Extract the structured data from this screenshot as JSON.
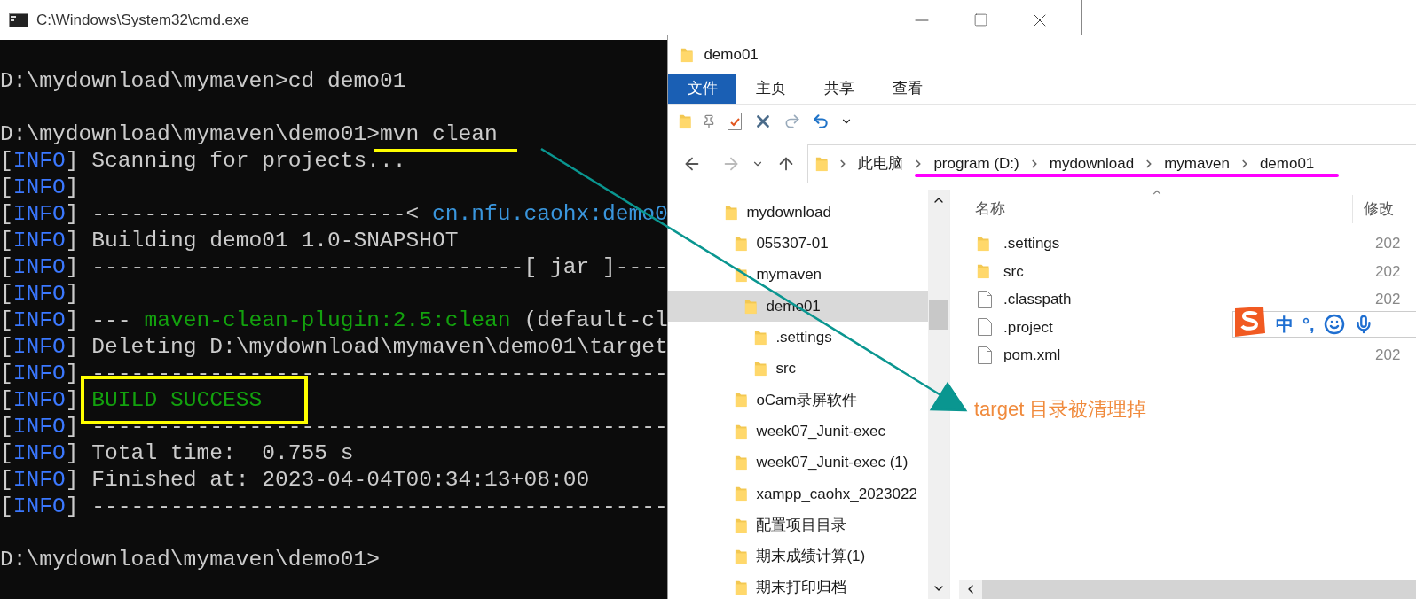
{
  "console_window": {
    "title": "C:\\Windows\\System32\\cmd.exe",
    "lines": [
      {
        "kind": "blank"
      },
      {
        "kind": "text",
        "segments": [
          {
            "kind": "plain",
            "text": "D:\\mydownload\\mymaven>cd demo01"
          }
        ]
      },
      {
        "kind": "blank"
      },
      {
        "kind": "text",
        "segments": [
          {
            "kind": "plain",
            "text": "D:\\mydownload\\mymaven\\demo01>"
          },
          {
            "kind": "plain",
            "text": "mvn clean",
            "underlined": true
          }
        ]
      },
      {
        "kind": "log",
        "tag": [
          "[",
          "INFO",
          "]"
        ],
        "segments": [
          {
            "kind": "plain",
            "text": "Scanning for projects..."
          }
        ]
      },
      {
        "kind": "log",
        "tag": [
          "[",
          "INFO",
          "]"
        ]
      },
      {
        "kind": "log",
        "tag": [
          "[",
          "INFO",
          "]"
        ],
        "segments": [
          {
            "kind": "plain",
            "text": "------------------------< "
          },
          {
            "kind": "artifact",
            "text": "cn.nfu.caohx:demo0"
          }
        ]
      },
      {
        "kind": "log",
        "tag": [
          "[",
          "INFO",
          "]"
        ],
        "segments": [
          {
            "kind": "plain",
            "text": "Building demo01 1.0-SNAPSHOT"
          }
        ]
      },
      {
        "kind": "log",
        "tag": [
          "[",
          "INFO",
          "]"
        ],
        "segments": [
          {
            "kind": "plain",
            "text": "---------------------------------[ jar ]----"
          }
        ]
      },
      {
        "kind": "log",
        "tag": [
          "[",
          "INFO",
          "]"
        ]
      },
      {
        "kind": "log",
        "tag": [
          "[",
          "INFO",
          "]"
        ],
        "segments": [
          {
            "kind": "plain",
            "text": "--- "
          },
          {
            "kind": "plugin",
            "text": "maven-clean-plugin:2.5:clean"
          },
          {
            "kind": "plain",
            "text": " (default-cl"
          }
        ]
      },
      {
        "kind": "log",
        "tag": [
          "[",
          "INFO",
          "]"
        ],
        "segments": [
          {
            "kind": "plain",
            "text": "Deleting D:\\mydownload\\mymaven\\demo01\\target"
          }
        ]
      },
      {
        "kind": "log",
        "tag": [
          "[",
          "INFO",
          "]"
        ],
        "segments": [
          {
            "kind": "plain",
            "text": "--------------------------------------------"
          }
        ]
      },
      {
        "kind": "log",
        "tag": [
          "[",
          "INFO",
          "]"
        ],
        "segments": [
          {
            "kind": "success",
            "text": "BUILD SUCCESS",
            "boxed": true
          }
        ]
      },
      {
        "kind": "log",
        "tag": [
          "[",
          "INFO",
          "]"
        ],
        "segments": [
          {
            "kind": "plain",
            "text": "--------------------------------------------"
          }
        ]
      },
      {
        "kind": "log",
        "tag": [
          "[",
          "INFO",
          "]"
        ],
        "segments": [
          {
            "kind": "plain",
            "text": "Total time:  0.755 s"
          }
        ]
      },
      {
        "kind": "log",
        "tag": [
          "[",
          "INFO",
          "]"
        ],
        "segments": [
          {
            "kind": "plain",
            "text": "Finished at: 2023-04-04T00:34:13+08:00"
          }
        ]
      },
      {
        "kind": "log",
        "tag": [
          "[",
          "INFO",
          "]"
        ],
        "segments": [
          {
            "kind": "plain",
            "text": "--------------------------------------------"
          }
        ]
      },
      {
        "kind": "blank"
      },
      {
        "kind": "text",
        "segments": [
          {
            "kind": "plain",
            "text": "D:\\mydownload\\mymaven\\demo01>"
          }
        ]
      }
    ]
  },
  "explorer_window": {
    "title": "demo01",
    "ribbon_tabs": [
      {
        "label": "文件",
        "selected": true
      },
      {
        "label": "主页",
        "selected": false
      },
      {
        "label": "共享",
        "selected": false
      },
      {
        "label": "查看",
        "selected": false
      }
    ],
    "breadcrumb": {
      "underlined": true,
      "parts": [
        "此电脑",
        "program (D:)",
        "mydownload",
        "mymaven",
        "demo01"
      ]
    },
    "nav_tree": [
      {
        "label": "mydownload",
        "selected": false,
        "children": [
          {
            "label": "055307-01",
            "selected": false
          },
          {
            "label": "mymaven",
            "selected": false,
            "children": [
              {
                "label": "demo01",
                "selected": true,
                "children": [
                  {
                    "label": ".settings",
                    "selected": false
                  },
                  {
                    "label": "src",
                    "selected": false
                  }
                ]
              }
            ]
          },
          {
            "label": "oCam录屏软件",
            "selected": false
          },
          {
            "label": "week07_Junit-exec",
            "selected": false
          },
          {
            "label": "week07_Junit-exec (1)",
            "selected": false
          },
          {
            "label": "xampp_caohx_2023022",
            "selected": false
          },
          {
            "label": "配置项目目录",
            "selected": false
          },
          {
            "label": "期末成绩计算(1)",
            "selected": false
          },
          {
            "label": "期末打印归档",
            "selected": false
          }
        ]
      }
    ],
    "columns": [
      "名称",
      "修改"
    ],
    "files": [
      {
        "kind": "folder",
        "name": ".settings",
        "date": "202"
      },
      {
        "kind": "folder",
        "name": "src",
        "date": "202"
      },
      {
        "kind": "file",
        "name": ".classpath",
        "date": "202"
      },
      {
        "kind": "file",
        "name": ".project"
      },
      {
        "kind": "file",
        "name": "pom.xml",
        "date": "202"
      }
    ],
    "annotation": "target 目录被清理掉",
    "ime_toolbar": {
      "items": [
        "中",
        "°,"
      ]
    }
  }
}
